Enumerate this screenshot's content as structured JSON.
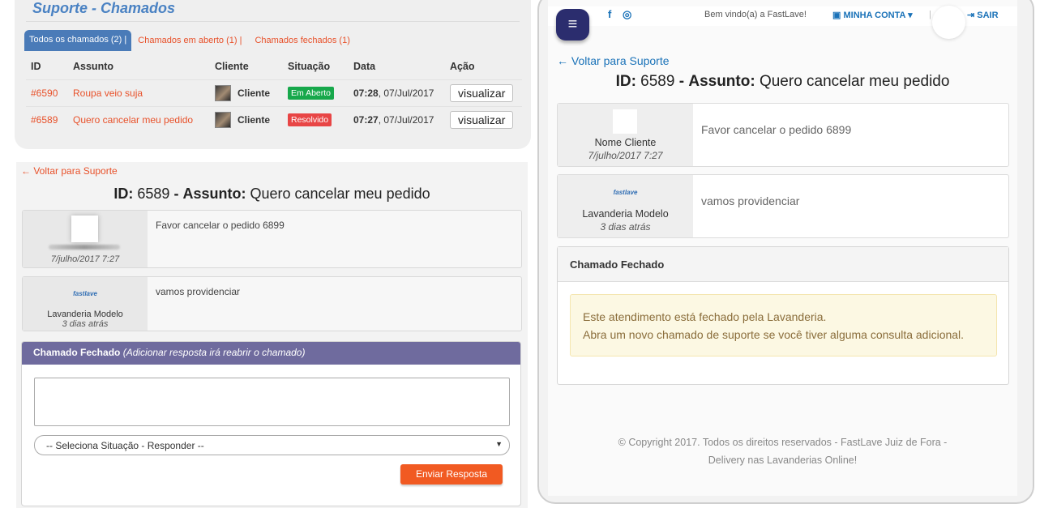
{
  "list": {
    "title": "Suporte - Chamados",
    "tabs": [
      "Todos os chamados (2)",
      "Chamados em aberto (1)",
      "Chamados fechados (1)"
    ],
    "tab_separator": "|",
    "columns": [
      "ID",
      "Assunto",
      "Cliente",
      "Situação",
      "Data",
      "Ação"
    ],
    "rows": [
      {
        "id": "#6590",
        "subject": "Roupa veio suja",
        "client": "Cliente",
        "status": "Em Aberto",
        "time": "07:28",
        "date": ", 07/Jul/2017",
        "action": "visualizar"
      },
      {
        "id": "#6589",
        "subject": "Quero cancelar meu pedido",
        "client": "Cliente",
        "status": "Resolvido",
        "time": "07:27",
        "date": ", 07/Jul/2017",
        "action": "visualizar"
      }
    ],
    "colors": {
      "open": "#17a84b",
      "resolved": "#e84545",
      "accent": "#e8512a",
      "tab_active": "#4a7bb8"
    }
  },
  "detail_left": {
    "back": "← Voltar para Suporte",
    "id_label": "ID:",
    "id_value": "6589",
    "dash": "-",
    "subject_label": "Assunto:",
    "subject_value": "Quero cancelar meu pedido",
    "messages": [
      {
        "author": "",
        "date": "7/julho/2017 7:27",
        "text": "Favor cancelar o pedido 6899"
      },
      {
        "logo": "fastlave",
        "author": "Lavanderia Modelo",
        "date": "3 dias atrás",
        "text": "vamos providenciar"
      }
    ],
    "reply": {
      "title": "Chamado Fechado",
      "hint": "(Adicionar resposta irá reabrir o chamado)",
      "select_value": "-- Seleciona Situação - Responder --",
      "send": "Enviar Resposta",
      "color_header": "#6f6b9e",
      "color_send": "#f15a22"
    }
  },
  "topbar": {
    "menu_icon": "≡",
    "facebook_icon": "f",
    "instagram_icon": "◎",
    "welcome": "Bem vindo(a) a FastLave!",
    "account_icon": "▣",
    "account": "MINHA CONTA",
    "account_caret": "▾",
    "logout_icon": "⇥",
    "logout": "SAIR"
  },
  "detail_right": {
    "back": "← Voltar para Suporte",
    "id_label": "ID:",
    "id_value": "6589",
    "dash": "-",
    "subject_label": "Assunto:",
    "subject_value": "Quero cancelar meu pedido",
    "messages": [
      {
        "author": "Nome Cliente",
        "date": "7/julho/2017 7:27",
        "text": "Favor cancelar o pedido 6899"
      },
      {
        "logo": "fastlave",
        "author": "Lavanderia Modelo",
        "date": "3 dias atrás",
        "text": "vamos providenciar"
      }
    ],
    "closed_title": "Chamado Fechado",
    "alert_line1": "Este atendimento está fechado pela Lavanderia.",
    "alert_line2": "Abra um novo chamado de suporte se você tiver alguma consulta adicional.",
    "footer_line1": "© Copyright 2017. Todos os direitos reservados - FastLave Juiz de Fora -",
    "footer_line2": "Delivery nas Lavanderias Online!"
  }
}
